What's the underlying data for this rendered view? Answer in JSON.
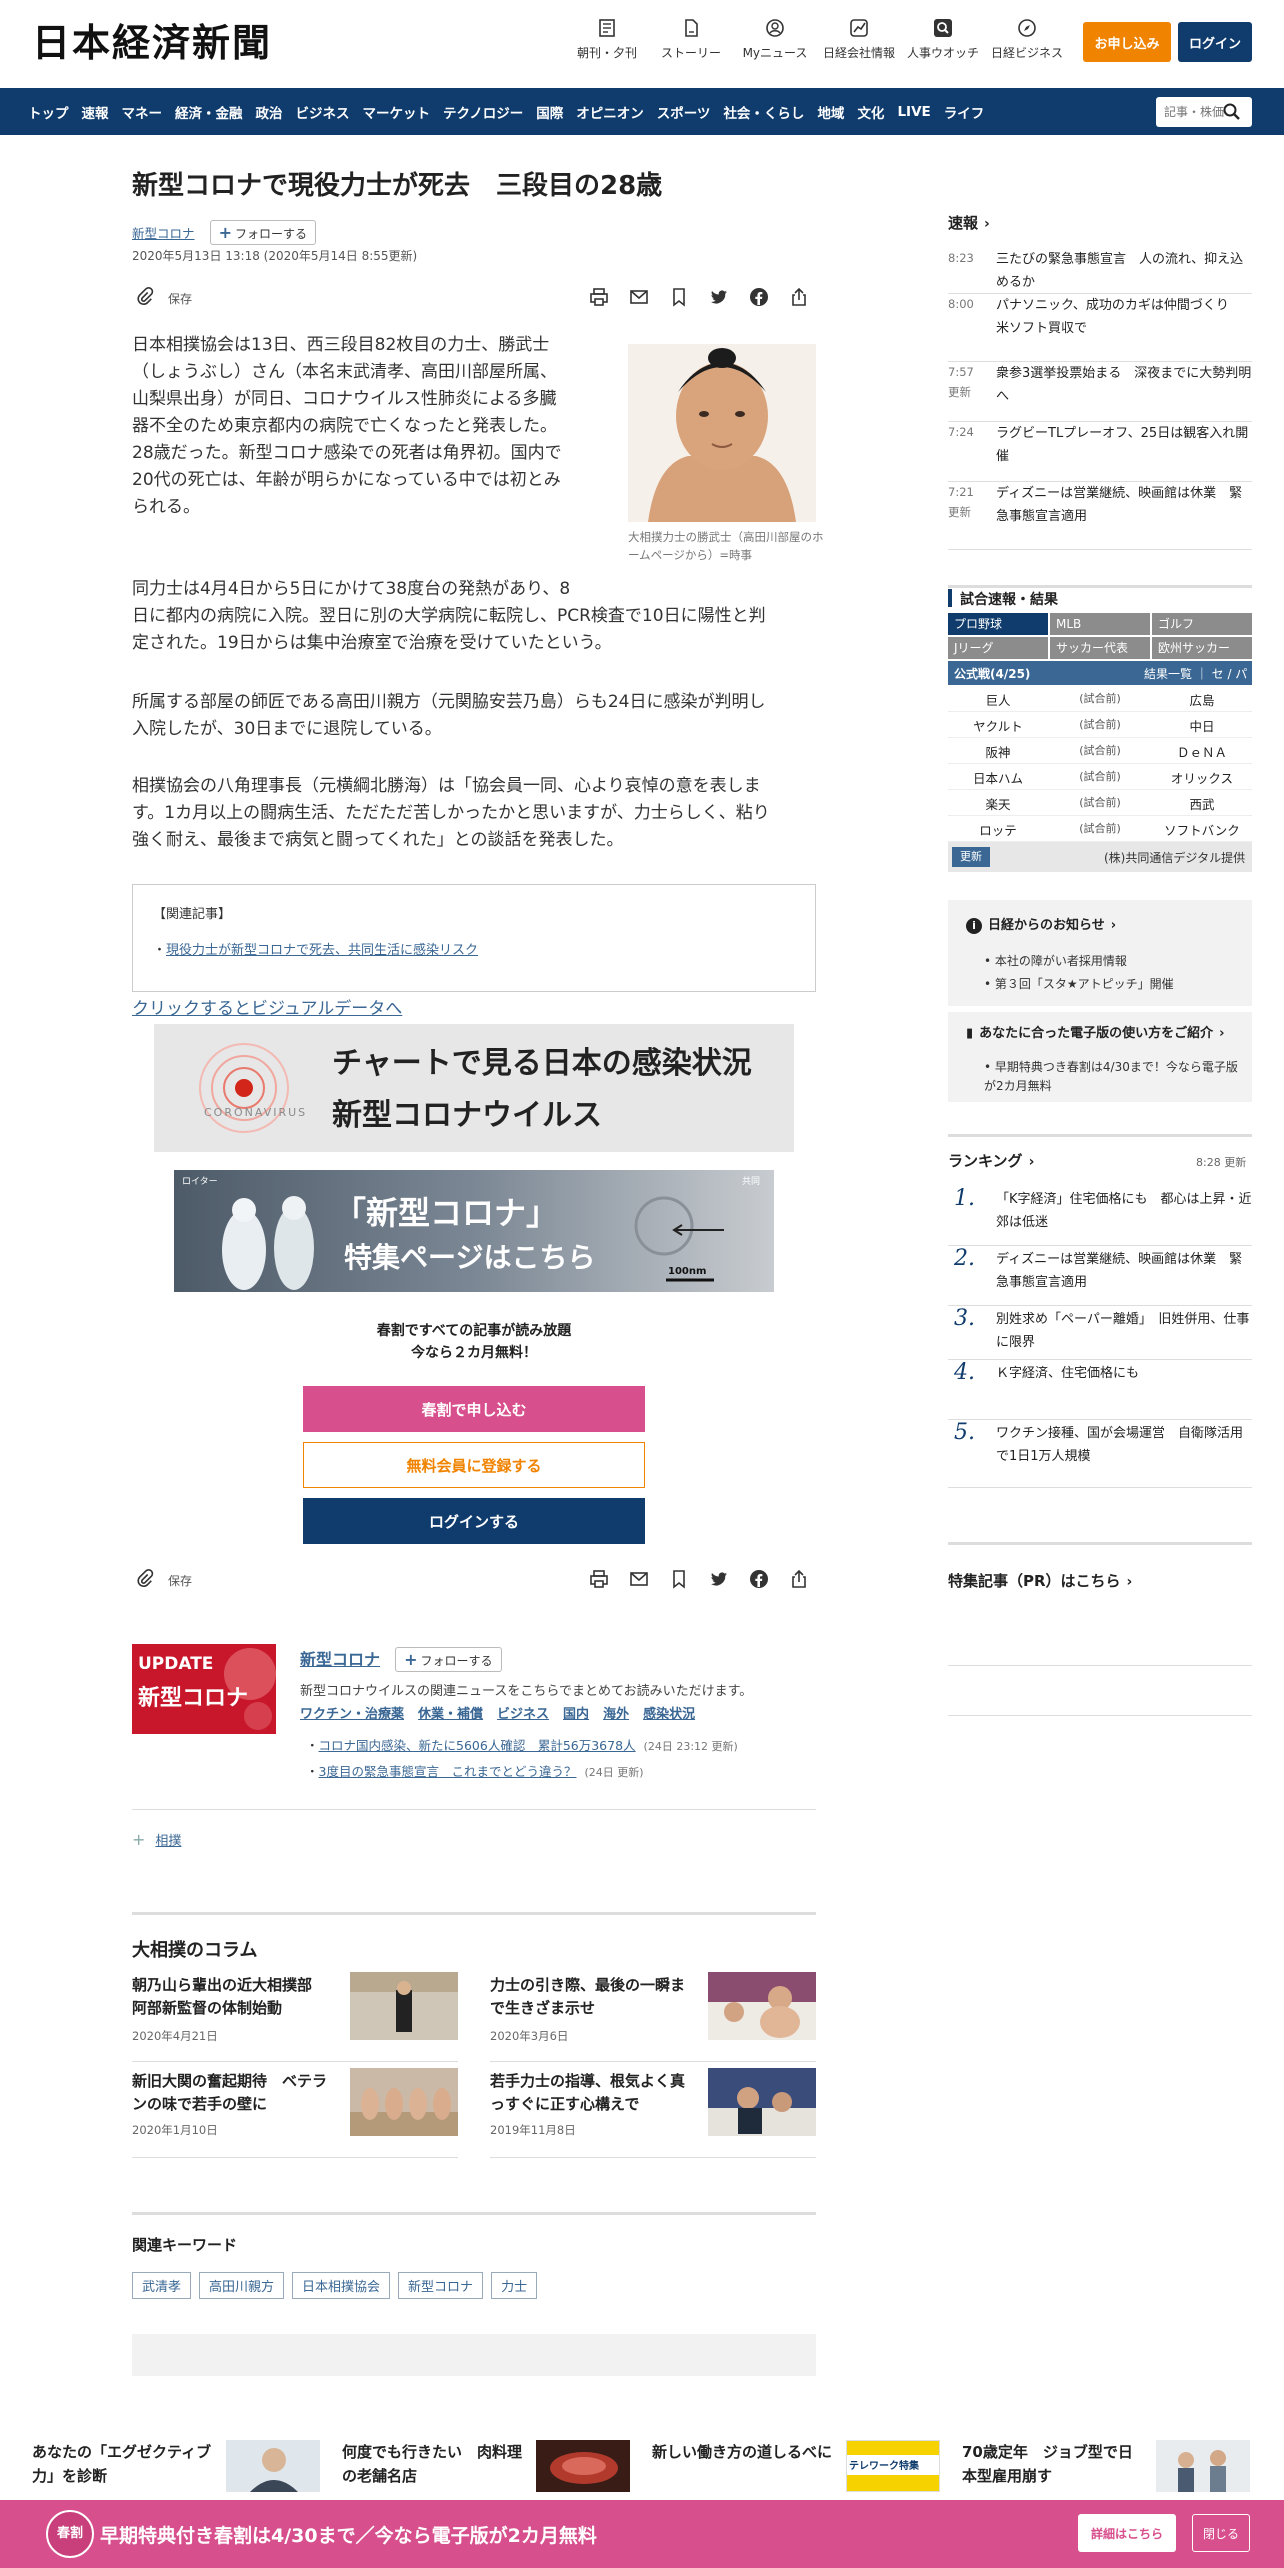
{
  "header": {
    "logo": "日本経済新聞",
    "icons": [
      {
        "label": "朝刊・夕刊",
        "icon": "newspaper-icon"
      },
      {
        "label": "ストーリー",
        "icon": "document-icon"
      },
      {
        "label": "Myニュース",
        "icon": "user-icon"
      },
      {
        "label": "日経会社情報",
        "icon": "chart-icon"
      },
      {
        "label": "人事ウオッチ",
        "icon": "search-icon"
      },
      {
        "label": "日経ビジネス",
        "icon": "compass-icon"
      }
    ],
    "apply_label": "お申し込み",
    "login_label": "ログイン"
  },
  "nav": {
    "items": [
      "トップ",
      "速報",
      "マネー",
      "経済・金融",
      "政治",
      "ビジネス",
      "マーケット",
      "テクノロジー",
      "国際",
      "オピニオン",
      "スポーツ",
      "社会・くらし",
      "地域",
      "文化",
      "LIVE",
      "ライフ"
    ],
    "search_placeholder": "記事・株価"
  },
  "article": {
    "title": "新型コロナで現役力士が死去　三段目の28歳",
    "topic": "新型コロナ",
    "follow_label": "フォローする",
    "date": "2020年5月13日 13:18 (2020年5月14日 8:55更新)",
    "save_label": "保存",
    "p1": "日本相撲協会は13日、西三段目82枚目の力士、勝武士（しょうぶし）さん（本名末武清孝、高田川部屋所属、山梨県出身）が同日、コロナウイルス性肺炎による多臓器不全のため東京都内の病院で亡くなったと発表した。28歳だった。新型コロナ感染での死者は角界初。国内で20代の死亡は、年齢が明らかになっている中では初とみられる。",
    "p1_lines": [
      "日本相撲協会は13日、西三段目82枚目の力士、勝武士",
      "（しょうぶし）さん（本名末武清孝、高田川部屋所属、",
      "山梨県出身）が同日、コロナウイルス性肺炎による多臓",
      "器不全のため東京都内の病院で亡くなったと発表した。",
      "28歳だった。新型コロナ感染での死者は角界初。国内で",
      "20代の死亡は、年齢が明らかになっている中では初とみ",
      "られる。"
    ],
    "photo_caption": "大相撲力士の勝武士（高田川部屋のホームページから）=時事",
    "p2_lines": [
      "同力士は4月4日から5日にかけて38度台の発熱があり、8",
      "日に都内の病院に入院。翌日に別の大学病院に転院し、PCR検査で10日に陽性と判",
      "定された。19日からは集中治療室で治療を受けていたという。"
    ],
    "p3_lines": [
      "所属する部屋の師匠である高田川親方（元関脇安芸乃島）らも24日に感染が判明し",
      "入院したが、30日までに退院している。"
    ],
    "p4_lines": [
      "相撲協会の八角理事長（元横綱北勝海）は「協会員一同、心より哀悼の意を表しま",
      "す。1カ月以上の闘病生活、ただただ苦しかったかと思いますが、力士らしく、粘り",
      "強く耐え、最後まで病気と闘ってくれた」との談話を発表した。"
    ],
    "related_heading": "【関連記事】",
    "related_link": "現役力士が新型コロナで死去、共同生活に感染リスク",
    "visual_link": "クリックするとビジュアルデータへ",
    "banner1_line1": "チャートで見る日本の感染状況",
    "banner1_line2": "新型コロナウイルス",
    "banner1_badge": "CORONAVIRUS",
    "banner2_line1": "「新型コロナ」",
    "banner2_line2": "特集ページはこちら",
    "banner2_scale": "100nm",
    "banner2_credit_left": "ロイター",
    "banner2_credit_right": "共同"
  },
  "promo": {
    "line1": "春割ですべての記事が読み放題",
    "line2": "今なら２カ月無料！",
    "btn_subscribe": "春割で申し込む",
    "btn_free": "無料会員に登録する",
    "btn_login": "ログインする"
  },
  "topic_box": {
    "image_line1": "UPDATE",
    "image_line2": "新型コロナ",
    "title": "新型コロナ",
    "follow_label": "フォローする",
    "desc": "新型コロナウイルスの関連ニュースをこちらでまとめてお読みいただけます。",
    "sublinks": [
      "ワクチン・治療薬",
      "休業・補償",
      "ビジネス",
      "国内",
      "海外",
      "感染状況"
    ],
    "items": [
      {
        "text": "コロナ国内感染、新たに5606人確認　累計56万3678人",
        "time": "(24日 23:12 更新)"
      },
      {
        "text": "3度目の緊急事態宣言　これまでとどう違う？",
        "time": "(24日 更新)"
      }
    ],
    "tag": "相撲"
  },
  "column": {
    "heading": "大相撲のコラム",
    "items": [
      {
        "title": "朝乃山ら輩出の近大相撲部　阿部新監督の体制始動",
        "date": "2020年4月21日"
      },
      {
        "title": "力士の引き際、最後の一瞬まで生きざま示せ",
        "date": "2020年3月6日"
      },
      {
        "title": "新旧大関の奮起期待　ベテランの味で若手の壁に",
        "date": "2020年1月10日"
      },
      {
        "title": "若手力士の指導、根気よく真っすぐに正す心構えで",
        "date": "2019年11月8日"
      }
    ]
  },
  "keywords": {
    "heading": "関連キーワード",
    "items": [
      "武清孝",
      "高田川親方",
      "日本相撲協会",
      "新型コロナ",
      "力士"
    ]
  },
  "sidebar": {
    "flash_heading": "速報",
    "flash": [
      {
        "time": "8:23",
        "text": "三たびの緊急事態宣言　人の流れ、抑え込めるか"
      },
      {
        "time": "8:00",
        "text": "パナソニック、成功のカギは仲間づくり　米ソフト買収で"
      },
      {
        "time": "7:57更新",
        "text": "衆参3選挙投票始まる　深夜までに大勢判明へ"
      },
      {
        "time": "7:24",
        "text": "ラグビーTLプレーオフ、25日は観客入れ開催"
      },
      {
        "time": "7:21更新",
        "text": "ディズニーは営業継続、映画館は休業　緊急事態宣言適用"
      }
    ],
    "score_heading": "試合速報・結果",
    "score_tabs": [
      "プロ野球",
      "MLB",
      "ゴルフ",
      "Jリーグ",
      "サッカー代表",
      "欧州サッカー"
    ],
    "score_sub": "公式戦(4/25)",
    "score_sub_links": "結果一覧 ｜ セ / パ",
    "games": [
      {
        "home": "巨人",
        "status": "(試合前)",
        "away": "広島"
      },
      {
        "home": "ヤクルト",
        "status": "(試合前)",
        "away": "中日"
      },
      {
        "home": "阪神",
        "status": "(試合前)",
        "away": "ＤｅＮＡ"
      },
      {
        "home": "日本ハム",
        "status": "(試合前)",
        "away": "オリックス"
      },
      {
        "home": "楽天",
        "status": "(試合前)",
        "away": "西武"
      },
      {
        "home": "ロッテ",
        "status": "(試合前)",
        "away": "ソフトバンク"
      }
    ],
    "score_update": "更新",
    "score_credit": "(株)共同通信デジタル提供",
    "notice_heading": "日経からのお知らせ",
    "notices": [
      "本社の障がい者採用情報",
      "第３回「スタ★アトピッチ」開催"
    ],
    "howto_heading": "あなたに合った電子版の使い方をご紹介",
    "howto_item": "早期特典つき春割は4/30まで！今なら電子版が2カ月無料",
    "ranking_heading": "ランキング",
    "ranking_time": "8:28  更新",
    "ranking": [
      {
        "rank": "1.",
        "text": "「K字経済」住宅価格にも　都心は上昇・近郊は低迷"
      },
      {
        "rank": "2.",
        "text": "ディズニーは営業継続、映画館は休業　緊急事態宣言適用"
      },
      {
        "rank": "3.",
        "text": "別姓求め「ペーパー離婚」　旧姓併用、仕事に限界"
      },
      {
        "rank": "4.",
        "text": "Ｋ字経済、住宅価格にも"
      },
      {
        "rank": "5.",
        "text": "ワクチン接種、国が会場運営　自衛隊活用で1日1万人規模"
      }
    ],
    "pr_heading": "特集記事（PR）はこちら"
  },
  "bottom_strip": [
    {
      "text": "あなたの「エグゼクティブ力」を診断"
    },
    {
      "text": "何度でも行きたい　肉料理の老舗名店"
    },
    {
      "text": "新しい働き方の道しるべに",
      "badge": "テレワーク特集"
    },
    {
      "text": "70歳定年　ジョブ型で日本型雇用崩す"
    }
  ],
  "footer_bar": {
    "badge": "春割",
    "text": "早期特典付き春割は4/30まで／今なら電子版が2カ月無料",
    "detail_label": "詳細はこちら",
    "close_label": "閉じる"
  },
  "colors": {
    "navy": "#0f3c6d",
    "orange": "#f08300",
    "pink": "#d74f8c",
    "link": "#3a6794"
  }
}
